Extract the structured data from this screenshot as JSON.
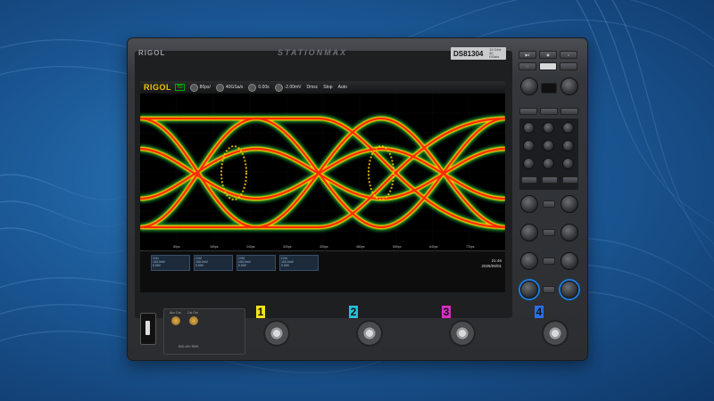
{
  "device": {
    "brand": "RIGOL",
    "series_logo": "STATIONMAX",
    "model": "DS81304",
    "model_sub": "13 GHz 40 GSa/s"
  },
  "display": {
    "topbar": {
      "logo": "RIGOL",
      "mode": "TD",
      "items": [
        "80ps/",
        "40GSa/s",
        "0.00s",
        "-2.00mV",
        "Dmsc",
        "Stop",
        "Auto"
      ]
    },
    "x_ticks": [
      "80ps",
      "160ps",
      "240ps",
      "320ps",
      "400ps",
      "480ps",
      "560ps",
      "640ps",
      "720ps"
    ],
    "y_ticks": [
      "",
      "",
      "",
      "",
      "",
      "",
      ""
    ],
    "channels": [
      {
        "label": "CH1",
        "line1": "100.0mV",
        "line2": "0.00V"
      },
      {
        "label": "CH2",
        "line1": "100.0mV",
        "line2": "0.00V"
      },
      {
        "label": "CH3",
        "line1": "100.0mV",
        "line2": "0.00V"
      },
      {
        "label": "CH4",
        "line1": "100.0mV",
        "line2": "0.00V"
      }
    ],
    "time": {
      "line1": "21:46",
      "line2": "2025/09/01"
    }
  },
  "front": {
    "aux_out": "Aux Out",
    "cal_out": "Cal Out",
    "channels": [
      "1",
      "2",
      "3",
      "4"
    ],
    "channel_colors": [
      "#f2e41d",
      "#23c1d8",
      "#d62ec9",
      "#2b6ee8"
    ],
    "rating": "50Ω ≤5V RMS"
  },
  "colors": {
    "eye_hot": "#ff2a00",
    "eye_mid": "#ffd000",
    "eye_cool": "#22e04a",
    "accent_blue": "#1e7bdc"
  }
}
